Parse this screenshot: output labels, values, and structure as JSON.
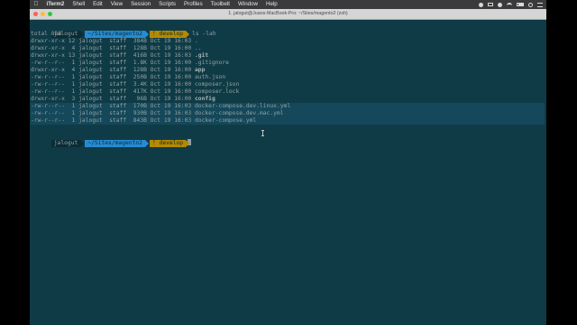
{
  "menubar": {
    "app_name": "iTerm2",
    "items": [
      "Shell",
      "Edit",
      "View",
      "Session",
      "Scripts",
      "Profiles",
      "Toolbelt",
      "Window",
      "Help"
    ]
  },
  "window": {
    "title": "1. jalogut@Juans-MacBook-Pro: ~/Sites/magento2 (zsh)"
  },
  "prompt": {
    "user": "jalogut",
    "path": "~/Sites/magento2",
    "branch": "develop",
    "branch_symbol": "ᚠ"
  },
  "command": "ls -lah",
  "total": "total 888",
  "listing": [
    {
      "perms": "drwxr-xr-x",
      "links": "12",
      "owner": "jalogut",
      "group": "staff",
      "size": "384B",
      "month": "Oct",
      "day": "19",
      "time": "16:03",
      "name": ".",
      "bold": false
    },
    {
      "perms": "drwxr-xr-x",
      "links": "4",
      "owner": "jalogut",
      "group": "staff",
      "size": "128B",
      "month": "Oct",
      "day": "19",
      "time": "16:00",
      "name": "..",
      "bold": false
    },
    {
      "perms": "drwxr-xr-x",
      "links": "13",
      "owner": "jalogut",
      "group": "staff",
      "size": "416B",
      "month": "Oct",
      "day": "19",
      "time": "16:03",
      "name": ".git",
      "bold": true
    },
    {
      "perms": "-rw-r--r--",
      "links": "1",
      "owner": "jalogut",
      "group": "staff",
      "size": "1.8K",
      "month": "Oct",
      "day": "19",
      "time": "16:00",
      "name": ".gitignore",
      "bold": false
    },
    {
      "perms": "drwxr-xr-x",
      "links": "4",
      "owner": "jalogut",
      "group": "staff",
      "size": "128B",
      "month": "Oct",
      "day": "19",
      "time": "16:00",
      "name": "app",
      "bold": true
    },
    {
      "perms": "-rw-r--r--",
      "links": "1",
      "owner": "jalogut",
      "group": "staff",
      "size": "250B",
      "month": "Oct",
      "day": "19",
      "time": "16:00",
      "name": "auth.json",
      "bold": false
    },
    {
      "perms": "-rw-r--r--",
      "links": "1",
      "owner": "jalogut",
      "group": "staff",
      "size": "3.4K",
      "month": "Oct",
      "day": "19",
      "time": "16:00",
      "name": "composer.json",
      "bold": false
    },
    {
      "perms": "-rw-r--r--",
      "links": "1",
      "owner": "jalogut",
      "group": "staff",
      "size": "417K",
      "month": "Oct",
      "day": "19",
      "time": "16:00",
      "name": "composer.lock",
      "bold": false
    },
    {
      "perms": "drwxr-xr-x",
      "links": "3",
      "owner": "jalogut",
      "group": "staff",
      "size": "96B",
      "month": "Oct",
      "day": "19",
      "time": "16:00",
      "name": "config",
      "bold": true
    },
    {
      "perms": "-rw-r--r--",
      "links": "1",
      "owner": "jalogut",
      "group": "staff",
      "size": "170B",
      "month": "Oct",
      "day": "19",
      "time": "16:03",
      "name": "docker-compose.dev.linux.yml",
      "bold": false
    },
    {
      "perms": "-rw-r--r--",
      "links": "1",
      "owner": "jalogut",
      "group": "staff",
      "size": "930B",
      "month": "Oct",
      "day": "19",
      "time": "16:03",
      "name": "docker-compose.dev.mac.yml",
      "bold": false
    },
    {
      "perms": "-rw-r--r--",
      "links": "1",
      "owner": "jalogut",
      "group": "staff",
      "size": "843B",
      "month": "Oct",
      "day": "19",
      "time": "16:03",
      "name": "docker-compose.yml",
      "bold": false
    }
  ],
  "highlighted_rows": [
    9,
    10,
    11
  ]
}
